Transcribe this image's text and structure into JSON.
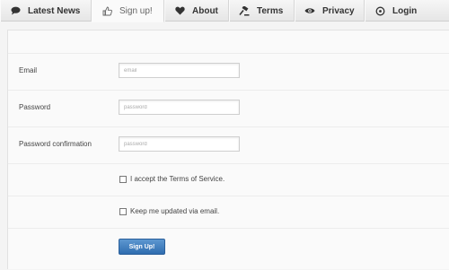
{
  "tabs": [
    {
      "label": "Latest News",
      "icon": "speech-bubble-icon"
    },
    {
      "label": "Sign up!",
      "icon": "thumbs-up-icon",
      "active": true
    },
    {
      "label": "About",
      "icon": "heart-icon"
    },
    {
      "label": "Terms",
      "icon": "gavel-icon"
    },
    {
      "label": "Privacy",
      "icon": "eye-icon"
    },
    {
      "label": "Login",
      "icon": "power-icon"
    }
  ],
  "form": {
    "email_label": "Email",
    "email_placeholder": "email",
    "email_value": "",
    "password_label": "Password",
    "password_placeholder": "password",
    "password_value": "",
    "confirm_label": "Password confirmation",
    "confirm_placeholder": "password",
    "confirm_value": "",
    "terms_label": "I accept the Terms of Service.",
    "terms_checked": false,
    "updates_label": "Keep me updated via email.",
    "updates_checked": false,
    "submit_label": "Sign Up!"
  },
  "colors": {
    "accent": "#3a78ba",
    "background": "#f4f4f4",
    "panel": "#fafafa"
  }
}
